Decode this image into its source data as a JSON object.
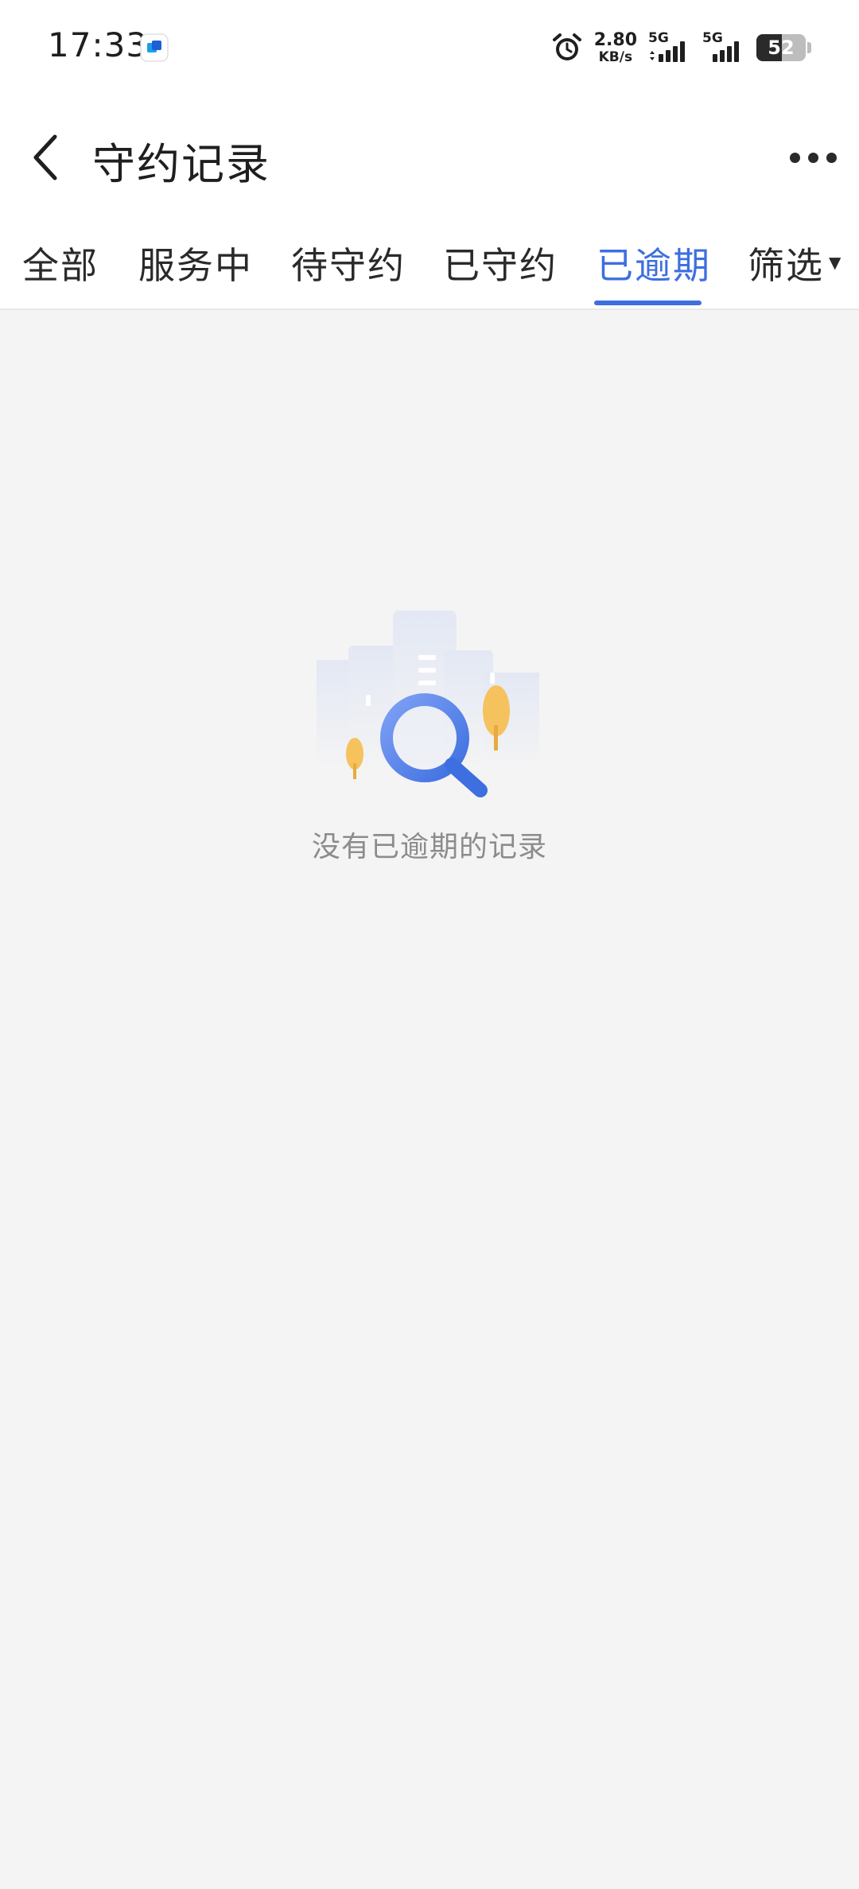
{
  "status_bar": {
    "time": "17:33",
    "net_speed_value": "2.80",
    "net_speed_unit": "KB/s",
    "signal1_label": "5G",
    "signal2_label": "5G",
    "battery_level": "52"
  },
  "header": {
    "title": "守约记录"
  },
  "tabs": {
    "items": [
      {
        "label": "全部"
      },
      {
        "label": "服务中"
      },
      {
        "label": "待守约"
      },
      {
        "label": "已守约"
      },
      {
        "label": "已逾期"
      }
    ],
    "active_index": 4,
    "filter_label": "筛选"
  },
  "empty_state": {
    "message": "没有已逾期的记录"
  },
  "colors": {
    "accent": "#3d6fe0",
    "background": "#f4f4f4"
  }
}
